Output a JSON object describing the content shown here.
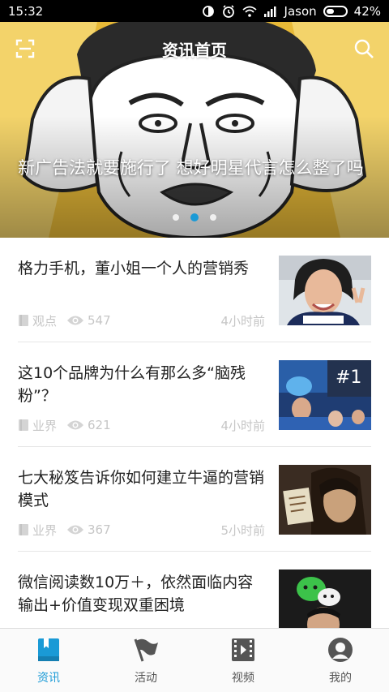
{
  "status_bar": {
    "time": "15:32",
    "carrier": "Jason",
    "battery": "42%",
    "battery_level": 0.42
  },
  "header": {
    "title": "资讯首页",
    "scan_icon": "scan-icon",
    "search_icon": "search-icon"
  },
  "hero": {
    "headline": "新广告法就要施行了 想好明星代言怎么整了吗",
    "dots_count": 3,
    "active_dot": 1
  },
  "articles": [
    {
      "title": "格力手机，董小姐一个人的营销秀",
      "category": "观点",
      "views": "547",
      "time": "4小时前"
    },
    {
      "title": "这10个品牌为什么有那么多“脑残粉”？",
      "category": "业界",
      "views": "621",
      "time": "4小时前"
    },
    {
      "title": "七大秘笈告诉你如何建立牛逼的营销模式",
      "category": "业界",
      "views": "367",
      "time": "5小时前"
    },
    {
      "title": "微信阅读数10万＋，依然面临内容输出+价值变现双重困境",
      "category": "",
      "views": "",
      "time": ""
    }
  ],
  "tabs": [
    {
      "label": "资讯",
      "icon": "news-icon",
      "active": true
    },
    {
      "label": "活动",
      "icon": "flag-icon",
      "active": false
    },
    {
      "label": "视频",
      "icon": "video-icon",
      "active": false
    },
    {
      "label": "我的",
      "icon": "profile-icon",
      "active": false
    }
  ],
  "colors": {
    "accent": "#1a9ad6",
    "meta_gray": "#c6c6c6",
    "title_text": "#222222"
  }
}
